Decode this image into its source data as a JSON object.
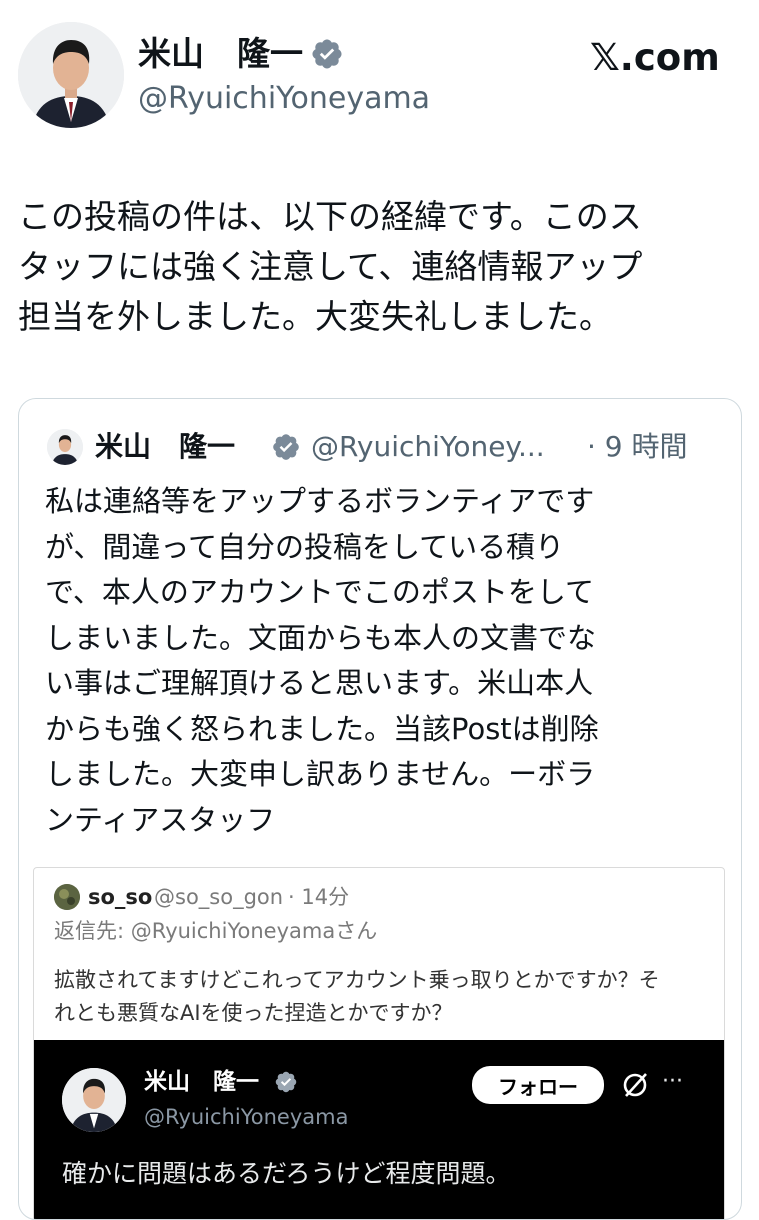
{
  "post": {
    "author_name": "米山　隆一",
    "handle": "@RyuichiYoneyama",
    "site": "𝕏.com",
    "body_lines": [
      "この投稿の件は、以下の経緯です。このス",
      "タッフには強く注意して、連絡情報アップ",
      "担当を外しました。大変失礼しました。"
    ]
  },
  "quote": {
    "author_name": "米山　隆一",
    "handle": "@RyuichiYoney...",
    "time": "· 9 時間",
    "body_lines": [
      "私は連絡等をアップするボランティアです",
      "が、間違って自分の投稿をしている積り",
      "で、本人のアカウントでこのポストをして",
      "しまいました。文面からも本人の文書でな",
      "い事はご理解頂けると思います。米山本人",
      "からも強く怒られました。当該Postは削除",
      "しました。大変申し訳ありません。ーボラ",
      "ンティアスタッフ"
    ]
  },
  "nested": {
    "author_name": "so_so",
    "handle": "@so_so_gon",
    "time": "· 14分",
    "reply_to": "返信先: @RyuichiYoneyamaさん",
    "body_lines": [
      "拡散されてますけどこれってアカウント乗っ取りとかですか？そ",
      "れとも悪質なAIを使った捏造とかですか？"
    ]
  },
  "dark_post": {
    "author_name": "米山　隆一",
    "handle": "@RyuichiYoneyama",
    "follow_label": "フォロー",
    "more_label": "···",
    "body": "確かに問題はあるだろうけど程度問題。"
  },
  "colors": {
    "verified": "#1d9bf0",
    "muted": "#536471",
    "card_border": "#cfd9de",
    "dark_bg": "#000000"
  },
  "icons": [
    "verified-badge-icon",
    "grok-icon",
    "more-icon"
  ]
}
